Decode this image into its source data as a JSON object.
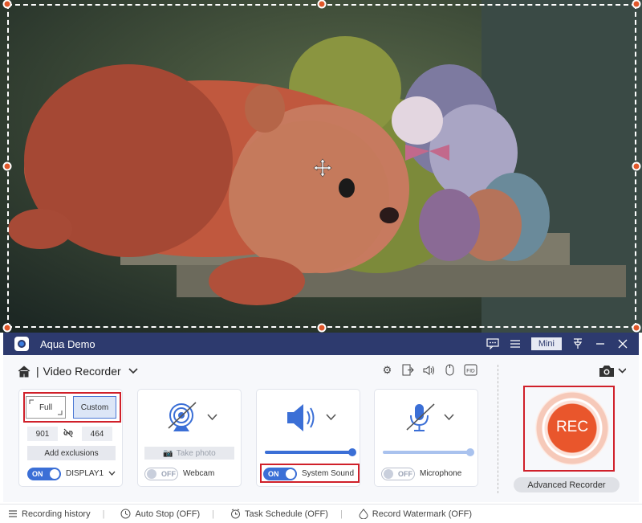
{
  "app": {
    "title": "Aqua Demo",
    "mini_label": "Mini"
  },
  "colors": {
    "titlebar": "#2d3a6e",
    "accent": "#3b6fd6",
    "rec": "#e9562c",
    "highlight": "#d0202a"
  },
  "header": {
    "separator": "|",
    "mode_label": "Video Recorder"
  },
  "area": {
    "full_label": "Full",
    "custom_label": "Custom",
    "width": "901",
    "height": "464",
    "exclusions_label": "Add exclusions",
    "toggle": "ON",
    "display": "DISPLAY1"
  },
  "webcam": {
    "take_photo": "Take photo",
    "toggle": "OFF",
    "label": "Webcam"
  },
  "system_sound": {
    "toggle": "ON",
    "label": "System Sound",
    "volume": 1.0
  },
  "microphone": {
    "toggle": "OFF",
    "label": "Microphone",
    "volume": 1.0
  },
  "rec": {
    "label": "REC",
    "advanced_label": "Advanced Recorder"
  },
  "statusbar": {
    "history": "Recording history",
    "auto_stop": "Auto Stop (OFF)",
    "schedule": "Task Schedule (OFF)",
    "watermark": "Record Watermark (OFF)"
  },
  "icons": [
    "home-icon",
    "chevron-down-icon",
    "gear-icon",
    "export-icon",
    "speaker-icon",
    "mouse-icon",
    "fid-icon",
    "camera-icon",
    "webcam-icon",
    "sound-icon",
    "mic-muted-icon",
    "list-icon",
    "feedback-icon",
    "pin-icon",
    "minimize-icon",
    "close-icon",
    "clock-icon",
    "calendar-icon",
    "watermark-icon",
    "move-icon"
  ]
}
